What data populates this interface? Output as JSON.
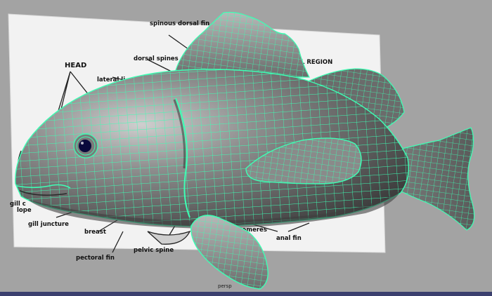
{
  "viewport": {
    "camera_label": "persp"
  },
  "reference_image": {
    "labels": {
      "head": "HEAD",
      "spinous_dorsal_fin": "spinous dorsal fin",
      "dorsal_spines": "dorsal spines",
      "lateral_line": "lateral li",
      "region": "L REGION",
      "gill_cover": "gill c",
      "operculum": "lope",
      "gill_juncture": "gill juncture",
      "breast": "breast",
      "pelvic_spine": "pelvic spine",
      "pectoral_fin": "pectoral fin",
      "myomeres": "myomeres",
      "anal_fin": "anal fin"
    }
  },
  "colors": {
    "background": "#a3a3a3",
    "wireframe": "#3dffb4",
    "mesh_shading": "#7d7d7d",
    "reference_paper": "#f2f2f2"
  }
}
